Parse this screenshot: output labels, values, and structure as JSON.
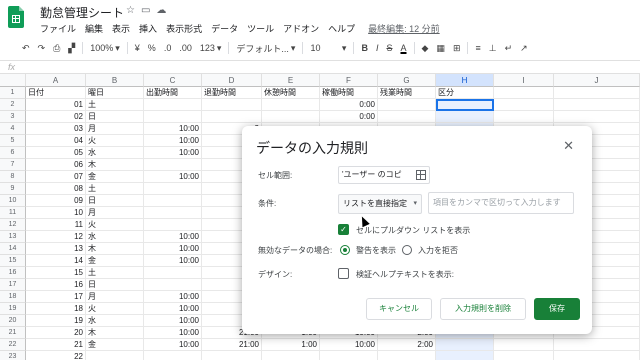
{
  "app": {
    "doc_title": "勤怠管理シート",
    "title_icons": [
      "star-icon",
      "folder-icon",
      "cloud-icon"
    ],
    "menu": [
      "ファイル",
      "編集",
      "表示",
      "挿入",
      "表示形式",
      "データ",
      "ツール",
      "アドオン",
      "ヘルプ"
    ],
    "last_edit": "最終編集: 12 分前"
  },
  "toolbar": {
    "zoom": "100%",
    "currency": "¥",
    "percent": "%",
    "decimal_dec": ".0",
    "decimal_inc": ".00",
    "format_num": "123",
    "font": "デフォルト...",
    "font_size": "10",
    "bold": "B",
    "italic": "I",
    "strike": "S",
    "text_color": "A"
  },
  "formula_bar": {
    "fx": "fx"
  },
  "sheet": {
    "columns": [
      "A",
      "B",
      "C",
      "D",
      "E",
      "F",
      "G",
      "H",
      "I",
      "J"
    ],
    "selected_column": "H",
    "headers": [
      "日付",
      "曜日",
      "出勤時間",
      "退勤時間",
      "休憩時間",
      "稼働時間",
      "残業時間",
      "区分"
    ],
    "rows": [
      {
        "n": "1",
        "a": "日付",
        "b": "曜日",
        "c": "出勤時間",
        "d": "退勤時間",
        "e": "休憩時間",
        "f": "稼働時間",
        "g": "残業時間",
        "h": "区分"
      },
      {
        "n": "2",
        "a": "01",
        "b": "土",
        "c": "",
        "d": "",
        "e": "",
        "f": "0:00",
        "g": "",
        "h": ""
      },
      {
        "n": "3",
        "a": "02",
        "b": "日",
        "c": "",
        "d": "",
        "e": "",
        "f": "0:00",
        "g": "",
        "h": ""
      },
      {
        "n": "4",
        "a": "03",
        "b": "月",
        "c": "10:00",
        "d": "2",
        "e": "",
        "f": "",
        "g": "",
        "h": ""
      },
      {
        "n": "5",
        "a": "04",
        "b": "火",
        "c": "10:00",
        "d": "",
        "e": "",
        "f": "",
        "g": "",
        "h": ""
      },
      {
        "n": "6",
        "a": "05",
        "b": "水",
        "c": "10:00",
        "d": "",
        "e": "",
        "f": "",
        "g": "",
        "h": ""
      },
      {
        "n": "7",
        "a": "06",
        "b": "木",
        "c": "",
        "d": "",
        "e": "",
        "f": "",
        "g": "",
        "h": ""
      },
      {
        "n": "8",
        "a": "07",
        "b": "金",
        "c": "10:00",
        "d": "2",
        "e": "",
        "f": "",
        "g": "",
        "h": ""
      },
      {
        "n": "9",
        "a": "08",
        "b": "土",
        "c": "",
        "d": "",
        "e": "",
        "f": "",
        "g": "",
        "h": ""
      },
      {
        "n": "10",
        "a": "09",
        "b": "日",
        "c": "",
        "d": "",
        "e": "",
        "f": "",
        "g": "",
        "h": ""
      },
      {
        "n": "11",
        "a": "10",
        "b": "月",
        "c": "",
        "d": "",
        "e": "",
        "f": "",
        "g": "",
        "h": ""
      },
      {
        "n": "12",
        "a": "11",
        "b": "火",
        "c": "",
        "d": "",
        "e": "",
        "f": "",
        "g": "",
        "h": ""
      },
      {
        "n": "13",
        "a": "12",
        "b": "水",
        "c": "10:00",
        "d": "",
        "e": "",
        "f": "",
        "g": "",
        "h": ""
      },
      {
        "n": "14",
        "a": "13",
        "b": "木",
        "c": "10:00",
        "d": "",
        "e": "",
        "f": "",
        "g": "",
        "h": ""
      },
      {
        "n": "15",
        "a": "14",
        "b": "金",
        "c": "10:00",
        "d": "2",
        "e": "",
        "f": "",
        "g": "",
        "h": ""
      },
      {
        "n": "16",
        "a": "15",
        "b": "土",
        "c": "",
        "d": "",
        "e": "",
        "f": "",
        "g": "",
        "h": ""
      },
      {
        "n": "17",
        "a": "16",
        "b": "日",
        "c": "",
        "d": "",
        "e": "",
        "f": "",
        "g": "",
        "h": ""
      },
      {
        "n": "18",
        "a": "17",
        "b": "月",
        "c": "10:00",
        "d": "",
        "e": "",
        "f": "",
        "g": "",
        "h": ""
      },
      {
        "n": "19",
        "a": "18",
        "b": "火",
        "c": "10:00",
        "d": "",
        "e": "",
        "f": "",
        "g": "",
        "h": ""
      },
      {
        "n": "20",
        "a": "19",
        "b": "水",
        "c": "10:00",
        "d": "",
        "e": "",
        "f": "",
        "g": "",
        "h": ""
      },
      {
        "n": "21",
        "a": "20",
        "b": "木",
        "c": "10:00",
        "d": "21:00",
        "e": "1:00",
        "f": "10:00",
        "g": "2:00",
        "h": ""
      },
      {
        "n": "22",
        "a": "21",
        "b": "金",
        "c": "10:00",
        "d": "21:00",
        "e": "1:00",
        "f": "10:00",
        "g": "2:00",
        "h": ""
      },
      {
        "n": "23",
        "a": "22",
        "b": "",
        "c": "",
        "d": "",
        "e": "",
        "f": "",
        "g": "",
        "h": ""
      }
    ]
  },
  "dialog": {
    "title": "データの入力規則",
    "range_label": "セル範囲:",
    "range_value": "'ユーザー のコピ",
    "criteria_label": "条件:",
    "criteria_value": "リストを直接指定",
    "list_placeholder": "項目をカンマで区切って入力します",
    "show_dropdown": "セルにプルダウン リストを表示",
    "invalid_label": "無効なデータの場合:",
    "warn_option": "警告を表示",
    "reject_option": "入力を拒否",
    "design_label": "デザイン:",
    "help_text_option": "検証ヘルプテキストを表示:",
    "cancel": "キャンセル",
    "remove": "入力規則を削除",
    "save": "保存"
  },
  "colors": {
    "accent_green": "#188038",
    "selection_blue": "#1a73e8",
    "selected_col_bg": "#e8f0fe"
  }
}
